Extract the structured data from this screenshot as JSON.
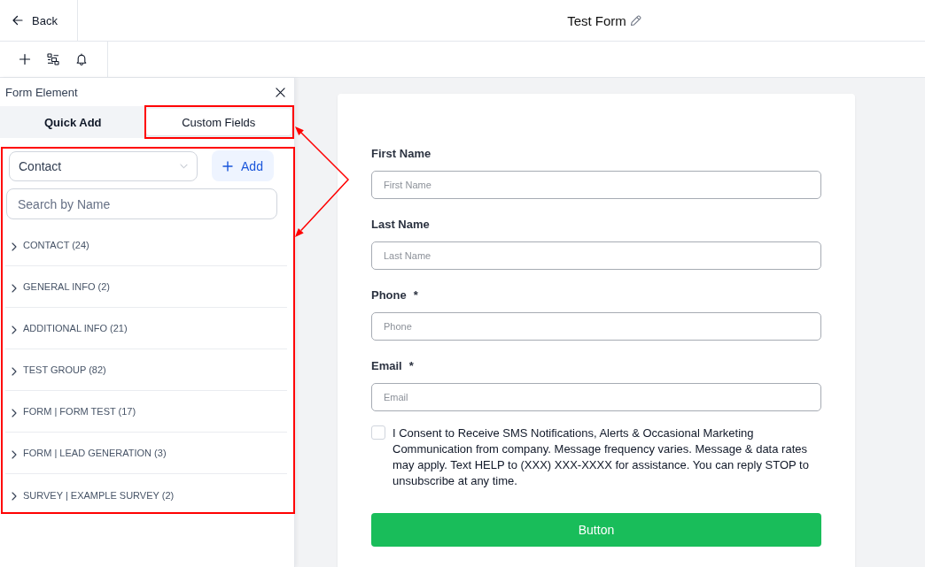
{
  "top_bar": {
    "back": "Back",
    "title": "Test Form"
  },
  "panel": {
    "title": "Form Element",
    "tabs": [
      {
        "label": "Quick Add",
        "selected": false
      },
      {
        "label": "Custom Fields",
        "selected": true
      }
    ],
    "object_select": {
      "value": "Contact"
    },
    "add_button": "Add",
    "search": {
      "placeholder": "Search by Name"
    },
    "groups": [
      {
        "label": "CONTACT (24)",
        "expanded": false
      },
      {
        "label": "GENERAL INFO (2)",
        "expanded": false
      },
      {
        "label": "ADDITIONAL INFO (21)",
        "expanded": false
      },
      {
        "label": "TEST GROUP (82)",
        "expanded": false
      },
      {
        "label": "FORM | FORM TEST (17)",
        "expanded": false
      },
      {
        "label": "FORM | LEAD GENERATION (3)",
        "expanded": false
      },
      {
        "label": "SURVEY | EXAMPLE SURVEY (2)",
        "expanded": false
      }
    ]
  },
  "form": {
    "fields": [
      {
        "label": "First Name",
        "placeholder": "First Name"
      },
      {
        "label": "Last Name",
        "placeholder": "Last Name"
      },
      {
        "label": "Phone",
        "required_mark": "*",
        "placeholder": "Phone"
      },
      {
        "label": "Email",
        "required_mark": "*",
        "placeholder": "Email"
      }
    ],
    "consent": {
      "checked": false,
      "text": "I Consent to Receive SMS Notifications, Alerts & Occasional Marketing Communication from company. Message frequency varies. Message & data rates may apply. Text HELP to (XXX) XXX-XXXX for assistance. You can reply STOP to unsubscribe at any time."
    },
    "submit": "Button"
  },
  "annotation": {
    "visible": true
  }
}
